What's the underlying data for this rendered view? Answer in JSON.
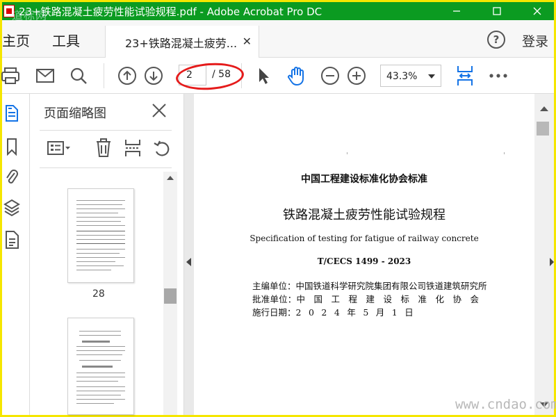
{
  "window": {
    "title": "23+铁路混凝土疲劳性能试验规程.pdf - Adobe Acrobat Pro DC",
    "watermark": "道标网"
  },
  "nav": {
    "home": "主页",
    "tools": "工具",
    "tab_label": "23+铁路混凝土疲劳...",
    "login": "登录",
    "help": "?"
  },
  "toolbar": {
    "page_current": "2",
    "page_total": "/ 58",
    "zoom": "43.3%"
  },
  "panel": {
    "title": "页面缩略图",
    "thumb_label": "28"
  },
  "document": {
    "org": "中国工程建设标准化协会标准",
    "title": "铁路混凝土疲劳性能试验规程",
    "english_title": "Specification of testing for fatigue of railway concrete",
    "code": "T/CECS 1499 - 2023",
    "editor_label": "主编单位：",
    "editor_value": "中国铁道科学研究院集团有限公司铁道建筑研究所",
    "approver_label": "批准单位：",
    "approver_value": "中国工程建设标准化协会",
    "date_label": "施行日期：",
    "date_value": "2024年5月1日"
  },
  "site_watermark": "www.cndao.com",
  "colors": {
    "title_bar": "#0b9b21",
    "frame": "#f5e600",
    "accent_icon": "#1473e6",
    "annotation": "#e51b1b"
  }
}
